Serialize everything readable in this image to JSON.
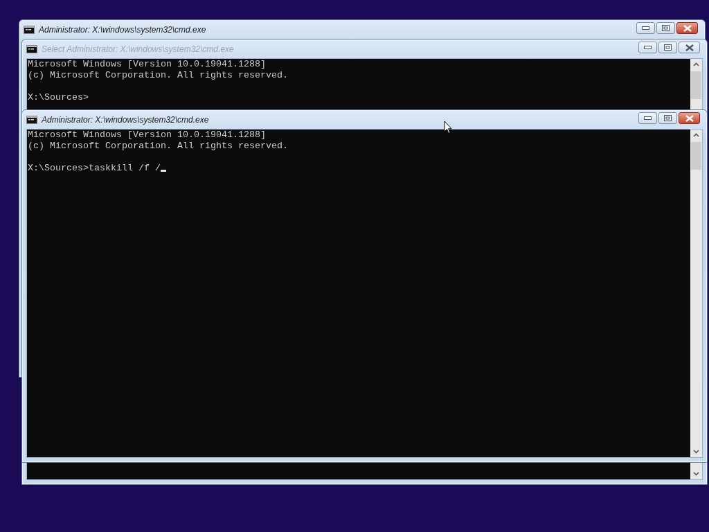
{
  "windows": [
    {
      "title": "Administrator: X:\\windows\\system32\\cmd.exe",
      "active": true
    },
    {
      "title": "Select Administrator: X:\\windows\\system32\\cmd.exe",
      "active": false,
      "lines": [
        "Microsoft Windows [Version 10.0.19041.1288]",
        "(c) Microsoft Corporation. All rights reserved."
      ],
      "prompt": "X:\\Sources>"
    },
    {
      "title": "Administrator: X:\\windows\\system32\\cmd.exe",
      "active": true,
      "lines": [
        "Microsoft Windows [Version 10.0.19041.1288]",
        "(c) Microsoft Corporation. All rights reserved."
      ],
      "prompt": "X:\\Sources>",
      "command": "taskkill /f /",
      "cursor": true
    }
  ]
}
